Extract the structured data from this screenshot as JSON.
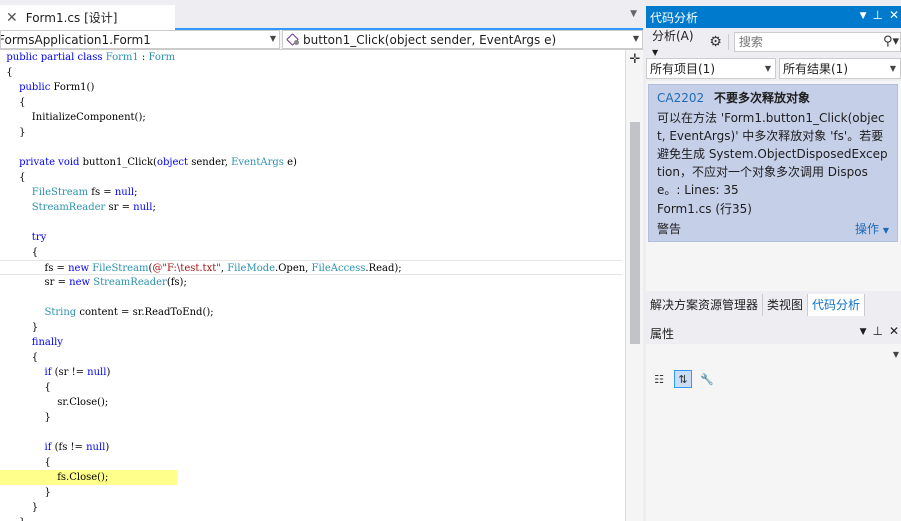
{
  "editor": {
    "tab_label": "Form1.cs [设计]",
    "nav_class": "FormsApplication1.Form1",
    "nav_method": "button1_Click(object sender, EventArgs e)",
    "code_lines": [
      {
        "segs": [
          {
            "t": "public partial class ",
            "c": "kw"
          },
          {
            "t": "Form1",
            "c": "ty"
          },
          {
            "t": " : ",
            "c": ""
          },
          {
            "t": "Form",
            "c": "ty"
          }
        ],
        "indent": "  "
      },
      {
        "segs": [
          {
            "t": "{",
            "c": ""
          }
        ],
        "indent": "  "
      },
      {
        "segs": [
          {
            "t": "public ",
            "c": "kw"
          },
          {
            "t": "Form1()",
            "c": ""
          }
        ],
        "indent": "      "
      },
      {
        "segs": [
          {
            "t": "{",
            "c": ""
          }
        ],
        "indent": "      "
      },
      {
        "segs": [
          {
            "t": "InitializeComponent();",
            "c": ""
          }
        ],
        "indent": "          "
      },
      {
        "segs": [
          {
            "t": "}",
            "c": ""
          }
        ],
        "indent": "      "
      },
      {
        "segs": [],
        "indent": ""
      },
      {
        "segs": [
          {
            "t": "private void ",
            "c": "kw"
          },
          {
            "t": "button1_Click(",
            "c": ""
          },
          {
            "t": "object ",
            "c": "kw"
          },
          {
            "t": "sender, ",
            "c": ""
          },
          {
            "t": "EventArgs",
            "c": "ty"
          },
          {
            "t": " e)",
            "c": ""
          }
        ],
        "indent": "      "
      },
      {
        "segs": [
          {
            "t": "{",
            "c": ""
          }
        ],
        "indent": "      "
      },
      {
        "segs": [
          {
            "t": "FileStream",
            "c": "ty"
          },
          {
            "t": " fs = ",
            "c": ""
          },
          {
            "t": "null",
            "c": "kw"
          },
          {
            "t": ";",
            "c": ""
          }
        ],
        "indent": "          "
      },
      {
        "segs": [
          {
            "t": "StreamReader",
            "c": "ty"
          },
          {
            "t": " sr = ",
            "c": ""
          },
          {
            "t": "null",
            "c": "kw"
          },
          {
            "t": ";",
            "c": ""
          }
        ],
        "indent": "          "
      },
      {
        "segs": [],
        "indent": ""
      },
      {
        "segs": [
          {
            "t": "try",
            "c": "kw"
          }
        ],
        "indent": "          "
      },
      {
        "segs": [
          {
            "t": "{",
            "c": ""
          }
        ],
        "indent": "          "
      },
      {
        "segs": [
          {
            "t": "fs = ",
            "c": ""
          },
          {
            "t": "new ",
            "c": "kw"
          },
          {
            "t": "FileStream",
            "c": "ty"
          },
          {
            "t": "(",
            "c": ""
          },
          {
            "t": "@\"F:\\test.txt\"",
            "c": "st"
          },
          {
            "t": ", ",
            "c": ""
          },
          {
            "t": "FileMode",
            "c": "ty"
          },
          {
            "t": ".Open, ",
            "c": ""
          },
          {
            "t": "FileAccess",
            "c": "ty"
          },
          {
            "t": ".Read);",
            "c": ""
          }
        ],
        "indent": "              ",
        "current": true
      },
      {
        "segs": [
          {
            "t": "sr = ",
            "c": ""
          },
          {
            "t": "new ",
            "c": "kw"
          },
          {
            "t": "StreamReader",
            "c": "ty"
          },
          {
            "t": "(fs);",
            "c": ""
          }
        ],
        "indent": "              "
      },
      {
        "segs": [],
        "indent": ""
      },
      {
        "segs": [
          {
            "t": "String",
            "c": "ty"
          },
          {
            "t": " content = sr.ReadToEnd();",
            "c": ""
          }
        ],
        "indent": "              "
      },
      {
        "segs": [
          {
            "t": "}",
            "c": ""
          }
        ],
        "indent": "          "
      },
      {
        "segs": [
          {
            "t": "finally",
            "c": "kw"
          }
        ],
        "indent": "          "
      },
      {
        "segs": [
          {
            "t": "{",
            "c": ""
          }
        ],
        "indent": "          "
      },
      {
        "segs": [
          {
            "t": "if ",
            "c": "kw"
          },
          {
            "t": "(sr != ",
            "c": ""
          },
          {
            "t": "null",
            "c": "kw"
          },
          {
            "t": ")",
            "c": ""
          }
        ],
        "indent": "              "
      },
      {
        "segs": [
          {
            "t": "{",
            "c": ""
          }
        ],
        "indent": "              "
      },
      {
        "segs": [
          {
            "t": "sr.Close();",
            "c": ""
          }
        ],
        "indent": "                  "
      },
      {
        "segs": [
          {
            "t": "}",
            "c": ""
          }
        ],
        "indent": "              "
      },
      {
        "segs": [],
        "indent": ""
      },
      {
        "segs": [
          {
            "t": "if ",
            "c": "kw"
          },
          {
            "t": "(fs != ",
            "c": ""
          },
          {
            "t": "null",
            "c": "kw"
          },
          {
            "t": ")",
            "c": ""
          }
        ],
        "indent": "              "
      },
      {
        "segs": [
          {
            "t": "{",
            "c": ""
          }
        ],
        "indent": "              "
      },
      {
        "segs": [
          {
            "t": "fs.Close();",
            "c": ""
          }
        ],
        "indent": "                  ",
        "highlight": true
      },
      {
        "segs": [
          {
            "t": "}",
            "c": ""
          }
        ],
        "indent": "              "
      },
      {
        "segs": [
          {
            "t": "}",
            "c": ""
          }
        ],
        "indent": "          "
      },
      {
        "segs": [
          {
            "t": "}",
            "c": ""
          }
        ],
        "indent": "      "
      }
    ]
  },
  "code_analysis": {
    "title": "代码分析",
    "analyze_label": "分析(A)",
    "search_placeholder": "搜索",
    "filter_items": "所有项目(1)",
    "filter_results": "所有结果(1)",
    "warning": {
      "code": "CA2202",
      "name": "不要多次释放对象",
      "message": "可以在方法 'Form1.button1_Click(object, EventArgs)' 中多次释放对象 'fs'。若要避免生成 System.ObjectDisposedException，不应对一个对象多次调用 Dispose。: Lines: 35",
      "location": "Form1.cs (行35)",
      "severity": "警告",
      "actions": "操作"
    }
  },
  "bottom_tabs": [
    "解决方案资源管理器",
    "类视图",
    "代码分析"
  ],
  "properties": {
    "title": "属性"
  },
  "colors": {
    "accent": "#007acc",
    "highlight": "#ffff8c",
    "keyword": "#0000ff",
    "type": "#2b91af",
    "string": "#a31515"
  }
}
